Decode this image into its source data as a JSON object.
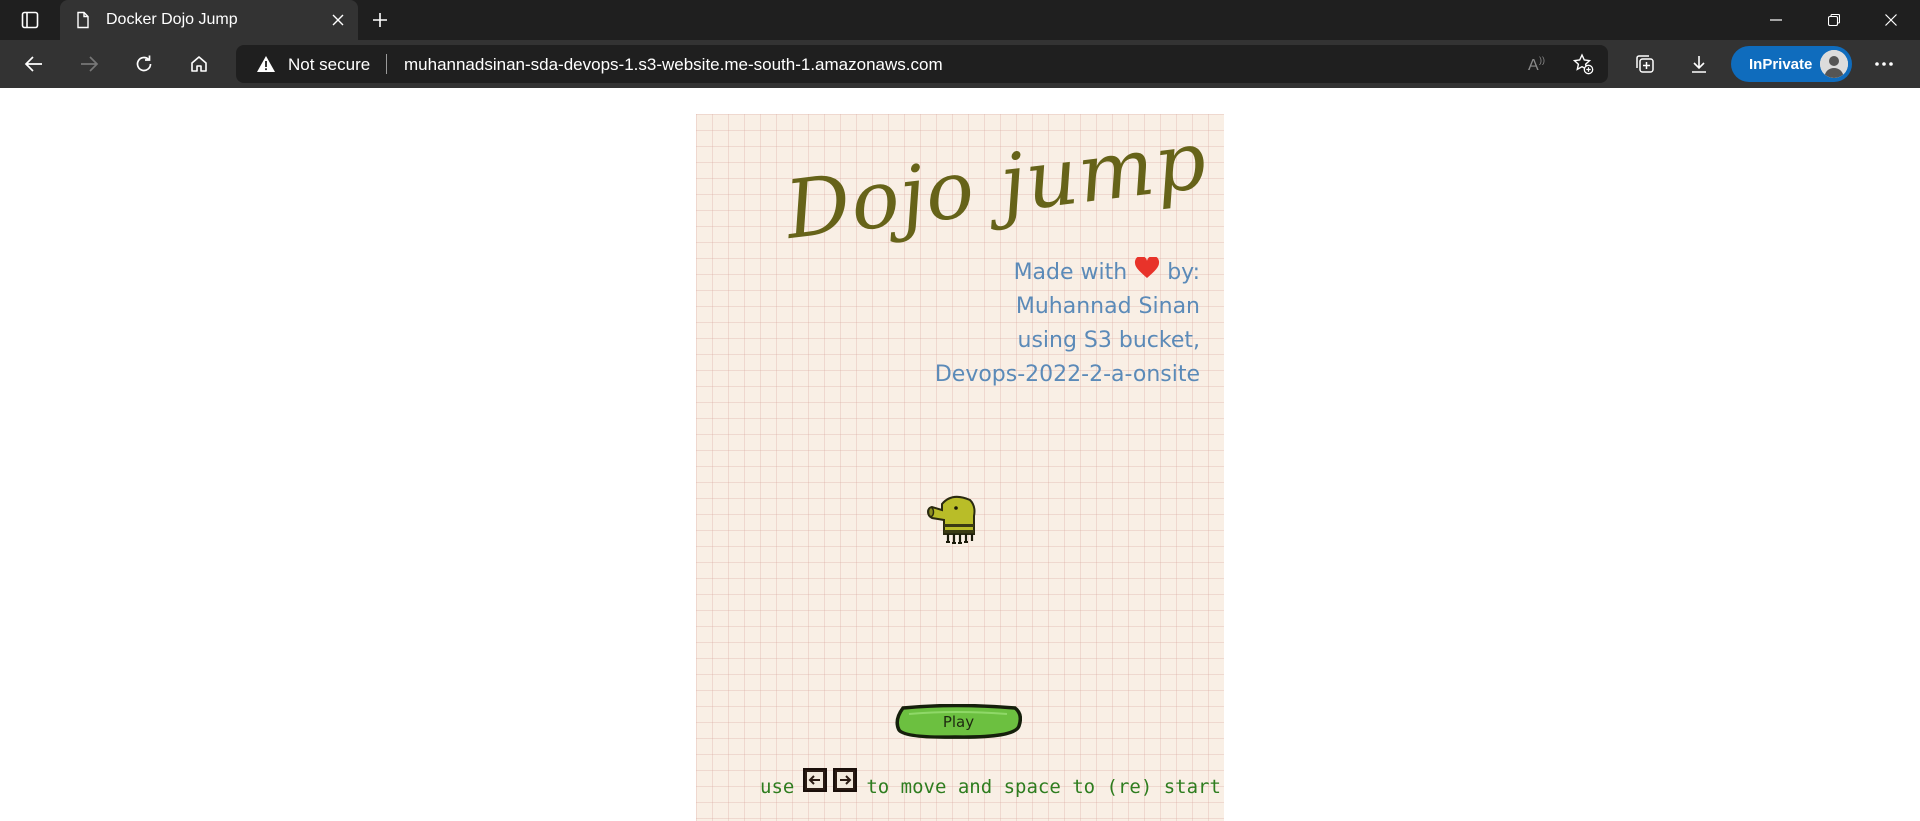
{
  "browser": {
    "tab": {
      "title": "Docker Dojo Jump"
    },
    "address": {
      "security_label": "Not secure",
      "url": "muhannadsinan-sda-devops-1.s3-website.me-south-1.amazonaws.com"
    },
    "profile": {
      "label": "InPrivate"
    },
    "icons": [
      "tab-actions-icon",
      "document-icon",
      "close-icon",
      "plus-icon",
      "minimize-icon",
      "restore-icon",
      "close-window-icon",
      "back-arrow-icon",
      "forward-arrow-icon",
      "refresh-icon",
      "home-icon",
      "warning-icon",
      "read-aloud-icon",
      "add-favorite-icon",
      "collections-icon",
      "download-icon",
      "avatar-icon",
      "more-icon"
    ]
  },
  "game": {
    "title": "Dojo jump",
    "credits": {
      "made_with": "Made with",
      "by": "by:",
      "author": "Muhannad Sinan",
      "platform": "using S3 bucket,",
      "cohort": "Devops-2022-2-a-onsite"
    },
    "play_label": "Play",
    "hint": {
      "prefix": "use",
      "suffix": "to move and space to (re) start..."
    },
    "colors": {
      "title": "#666319",
      "credits": "#5b8ab8",
      "hint": "#2e7d1f",
      "play_button": "#6cc040",
      "paper": "#f9efe5"
    }
  }
}
